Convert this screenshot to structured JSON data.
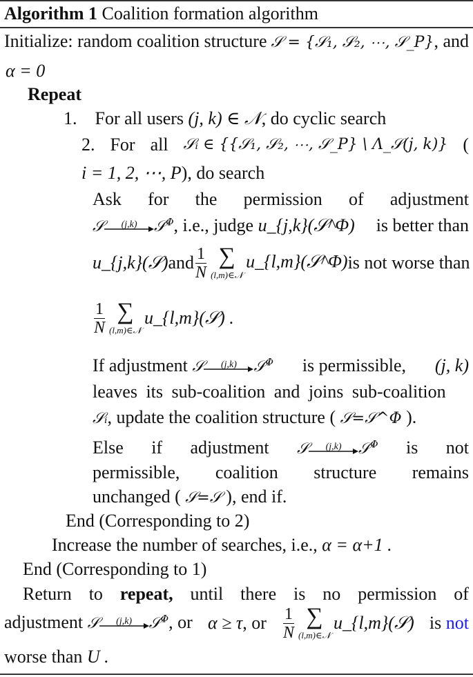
{
  "algorithm": {
    "label": "Algorithm 1",
    "title": "Coalition formation algorithm"
  },
  "lines": {
    "init_a": "Initialize: random coalition structure",
    "init_set": "𝒮 = {𝒮₁, 𝒮₂, ⋯, 𝒮_P}",
    "init_b": ", and",
    "init_alpha": "α = 0",
    "repeat": "Repeat",
    "step1_num": "1.",
    "step1_a": "For all users",
    "step1_math": "(j, k) ∈ 𝒩",
    "step1_b": ", do cyclic search",
    "step2_num": "2.",
    "step2_for": "For",
    "step2_all": "all",
    "step2_math": "𝒮ᵢ ∈ {{𝒮₁, 𝒮₂, ⋯, 𝒮_P} \\ Λ_𝒮(j, k)}",
    "step2_paren": "(",
    "step2_range": "i = 1, 2, ⋯, P",
    "step2_b": "), do search",
    "ask_words": [
      "Ask",
      "for",
      "the",
      "permission",
      "of",
      "adjustment"
    ],
    "arrow_label": "(j,k)",
    "ask_l2_b": ", i.e., judge",
    "ask_l2_u": "u_{j,k}(𝒮^Φ)",
    "ask_l2_c": "is better than",
    "ask_l3_a": "u_{j,k}(𝒮)",
    "ask_l3_and": "and",
    "ask_l3_sum": "u_{l,m}(𝒮^Φ)",
    "ask_l3_c": "is not worse than",
    "ask_l4_sum": "u_{l,m}(𝒮) .",
    "frac_num": "1",
    "frac_den": "N",
    "sum_limit": "(l,m)∈𝒩",
    "if_a": "If adjustment",
    "if_b": "is permissible,",
    "if_c": "(j, k)",
    "if_l2": "leaves its sub-coalition and joins sub-coalition",
    "if_l3_a": "𝒮ᵢ",
    "if_l3_b": ", update the coalition structure (",
    "if_l3_eq": "𝒮=𝒮^Φ",
    "if_l3_c": ").",
    "else_words": [
      "Else",
      "if",
      "adjustment"
    ],
    "else_is": "is",
    "else_not": "not",
    "else_l2": [
      "permissible,",
      "coalition",
      "structure",
      "remains"
    ],
    "else_l3_a": "unchanged (",
    "else_l3_eq": "𝒮=𝒮",
    "else_l3_b": "), end if.",
    "end2": "End (Corresponding to 2)",
    "increase_a": "Increase the number of searches, i.e.,",
    "increase_math": "α = α+1 .",
    "end1": "End (Corresponding to 1)",
    "return_words": [
      "Return",
      "to",
      "repeat,",
      "until",
      "there",
      "is",
      "no",
      "permission",
      "of"
    ],
    "return_l2_a": "adjustment",
    "return_l2_b": ", or",
    "return_l2_c": "α ≥ τ",
    "return_l2_d": ", or",
    "return_l2_sum": "u_{l,m}(𝒮)",
    "return_l2_is": "is",
    "return_l2_not": "not",
    "return_l3_a": "worse than",
    "return_l3_U": "U .",
    "highlight_color": "#1a1aff"
  }
}
